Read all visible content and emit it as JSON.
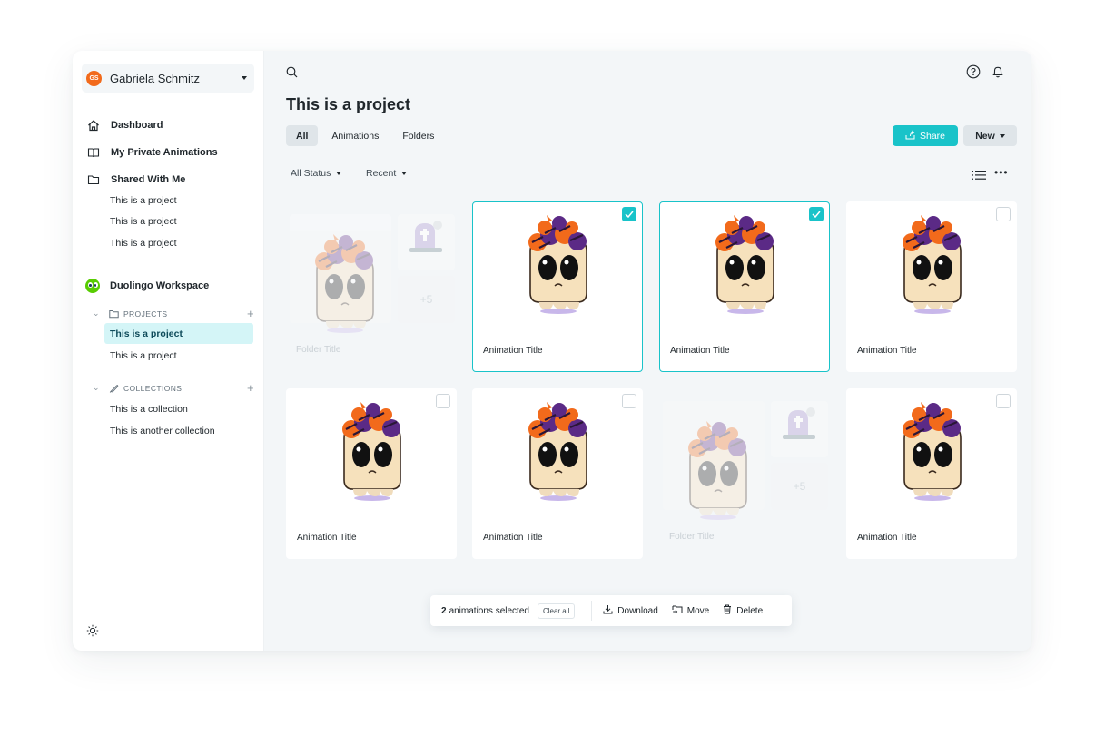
{
  "user": {
    "initials": "GS",
    "name": "Gabriela Schmitz"
  },
  "nav": {
    "dashboard": "Dashboard",
    "private": "My Private Animations",
    "shared": "Shared With Me",
    "shared_items": [
      "This is a project",
      "This is a project",
      "This is a project"
    ]
  },
  "workspace": {
    "name": "Duolingo Workspace",
    "projects_label": "PROJECTS",
    "projects": [
      "This is a project",
      "This is a project"
    ],
    "collections_label": "COLLECTIONS",
    "collections": [
      "This is a collection",
      "This is another collection"
    ]
  },
  "header": {
    "title": "This is a project"
  },
  "tabs": [
    "All",
    "Animations",
    "Folders"
  ],
  "buttons": {
    "share": "Share",
    "new": "New"
  },
  "filters": {
    "status": "All Status",
    "sort": "Recent"
  },
  "cards": [
    {
      "kind": "folder",
      "title": "Folder Title",
      "more": "+5"
    },
    {
      "kind": "animation",
      "title": "Animation Title",
      "selected": true
    },
    {
      "kind": "animation",
      "title": "Animation Title",
      "selected": true
    },
    {
      "kind": "animation",
      "title": "Animation Title",
      "selected": false
    },
    {
      "kind": "animation",
      "title": "Animation Title",
      "selected": false
    },
    {
      "kind": "animation",
      "title": "Animation Title",
      "selected": false
    },
    {
      "kind": "folder",
      "title": "Folder Title",
      "more": "+5"
    },
    {
      "kind": "animation",
      "title": "Animation Title",
      "selected": false
    }
  ],
  "selection_bar": {
    "count": "2",
    "count_suffix": "animations selected",
    "clear": "Clear all",
    "download": "Download",
    "move": "Move",
    "delete": "Delete"
  },
  "colors": {
    "accent": "#19c3c9",
    "avatar": "#f26a1b",
    "workspace_logo": "#58cc02",
    "active_row": "#d4f5f7"
  }
}
